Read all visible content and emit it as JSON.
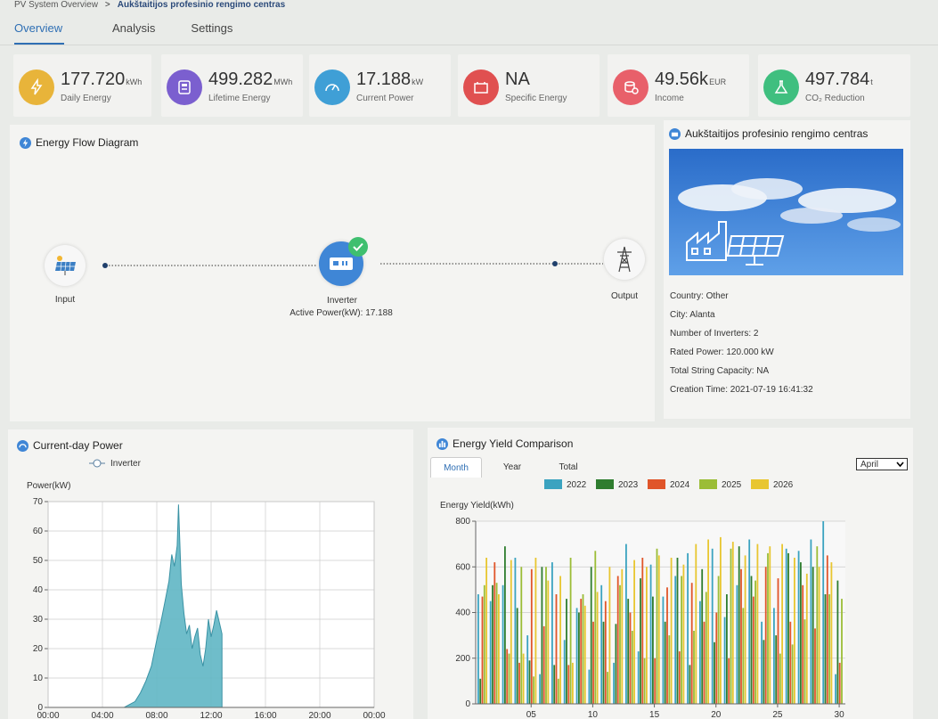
{
  "breadcrumb": {
    "root": "PV System Overview",
    "sep": ">",
    "current": "Aukštaitijos profesinio rengimo centras"
  },
  "tabs": [
    "Overview",
    "Analysis",
    "Settings"
  ],
  "kpis": [
    {
      "value": "177.720",
      "unit": "kWh",
      "label": "Daily Energy",
      "icon": "lightning-icon",
      "color": "#e8b43a"
    },
    {
      "value": "499.282",
      "unit": "MWh",
      "label": "Lifetime Energy",
      "icon": "meter-icon",
      "color": "#7b5fcf"
    },
    {
      "value": "17.188",
      "unit": "kW",
      "label": "Current Power",
      "icon": "gauge-icon",
      "color": "#3f9fd6"
    },
    {
      "value": "NA",
      "unit": "",
      "label": "Specific Energy",
      "icon": "battery-icon",
      "color": "#e05050"
    },
    {
      "value": "49.56k",
      "unit": "EUR",
      "label": "Income",
      "icon": "coins-icon",
      "color": "#e8606a"
    },
    {
      "value": "497.784",
      "unit": "t",
      "label": "CO₂ Reduction",
      "icon": "flask-icon",
      "color": "#3fbf7f"
    }
  ],
  "flow": {
    "title": "Energy Flow Diagram",
    "input_label": "Input",
    "inverter_label": "Inverter",
    "inverter_power": "Active Power(kW): 17.188",
    "output_label": "Output"
  },
  "site": {
    "title": "Aukštaitijos profesinio rengimo centras",
    "country": "Country: Other",
    "city": "City: Alanta",
    "inverters": "Number of Inverters: 2",
    "rated": "Rated Power: 120.000 kW",
    "capacity": "Total String Capacity: NA",
    "created": "Creation Time: 2021-07-19 16:41:32"
  },
  "power_chart": {
    "title": "Current-day Power",
    "chart_data": {
      "type": "area",
      "ylabel": "Power(kW)",
      "legend": [
        "Inverter"
      ],
      "ylim": [
        0,
        70
      ],
      "yticks": [
        0,
        10,
        20,
        30,
        40,
        50,
        60,
        70
      ],
      "xticks": [
        "00:00",
        "04:00",
        "08:00",
        "12:00",
        "16:00",
        "20:00",
        "00:00"
      ],
      "x_hours": [
        5.6,
        6.0,
        6.4,
        6.8,
        7.2,
        7.6,
        8.0,
        8.3,
        8.6,
        8.9,
        9.1,
        9.3,
        9.5,
        9.6,
        9.8,
        10.0,
        10.2,
        10.4,
        10.6,
        10.8,
        11.0,
        11.2,
        11.4,
        11.6,
        11.8,
        12.0,
        12.2,
        12.4,
        12.7,
        12.8
      ],
      "series": [
        {
          "name": "Inverter",
          "values": [
            0,
            1,
            2,
            5,
            9,
            14,
            23,
            29,
            36,
            43,
            52,
            48,
            55,
            69,
            42,
            32,
            25,
            28,
            20,
            24,
            27,
            18,
            14,
            20,
            30,
            24,
            28,
            33,
            27,
            25
          ]
        }
      ]
    }
  },
  "yield_chart": {
    "title": "Energy Yield Comparison",
    "tabs": [
      "Month",
      "Year",
      "Total"
    ],
    "month_select": "April",
    "chart_data": {
      "type": "bar",
      "ylabel": "Energy Yield(kWh)",
      "ylim": [
        0,
        800
      ],
      "yticks": [
        0,
        200,
        400,
        600,
        800
      ],
      "xticks": [
        "05",
        "10",
        "15",
        "20",
        "25",
        "30"
      ],
      "categories": [
        1,
        2,
        3,
        4,
        5,
        6,
        7,
        8,
        9,
        10,
        11,
        12,
        13,
        14,
        15,
        16,
        17,
        18,
        19,
        20,
        21,
        22,
        23,
        24,
        25,
        26,
        27,
        28,
        29,
        30
      ],
      "series": [
        {
          "name": "2022",
          "color": "#3ba3c0",
          "values": [
            480,
            450,
            520,
            640,
            300,
            130,
            620,
            280,
            420,
            150,
            520,
            180,
            700,
            230,
            610,
            470,
            560,
            660,
            450,
            680,
            380,
            520,
            720,
            360,
            420,
            680,
            670,
            720,
            800,
            130
          ]
        },
        {
          "name": "2023",
          "color": "#2f7d2f",
          "values": [
            110,
            520,
            690,
            420,
            190,
            600,
            170,
            460,
            400,
            600,
            360,
            350,
            460,
            550,
            470,
            360,
            640,
            170,
            590,
            270,
            480,
            690,
            560,
            280,
            300,
            660,
            620,
            600,
            480,
            540
          ]
        },
        {
          "name": "2024",
          "color": "#e0552a",
          "values": [
            470,
            620,
            240,
            180,
            590,
            340,
            480,
            170,
            460,
            360,
            450,
            560,
            400,
            640,
            200,
            510,
            230,
            530,
            360,
            400,
            200,
            590,
            470,
            600,
            550,
            360,
            520,
            330,
            650,
            180
          ]
        },
        {
          "name": "2025",
          "color": "#9bbd36",
          "values": [
            520,
            530,
            220,
            600,
            120,
            600,
            110,
            640,
            480,
            670,
            140,
            520,
            320,
            200,
            680,
            300,
            560,
            320,
            490,
            560,
            680,
            420,
            540,
            660,
            220,
            260,
            370,
            690,
            480,
            460
          ]
        },
        {
          "name": "2026",
          "color": "#e8c630",
          "values": [
            640,
            480,
            630,
            220,
            640,
            540,
            560,
            180,
            430,
            490,
            600,
            590,
            630,
            600,
            650,
            640,
            610,
            700,
            720,
            730,
            710,
            650,
            700,
            690,
            700,
            640,
            570,
            600,
            620,
            0
          ]
        }
      ]
    }
  }
}
